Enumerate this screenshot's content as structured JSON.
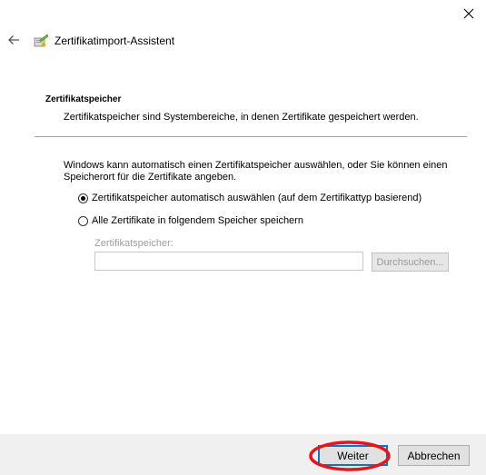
{
  "window": {
    "title": "Zertifikatimport-Assistent"
  },
  "header": {
    "close_icon": "close-icon",
    "back_icon": "back-arrow-icon",
    "wizard_icon": "certificate-wizard-icon"
  },
  "section": {
    "heading": "Zertifikatspeicher",
    "description": "Zertifikatspeicher sind Systembereiche, in denen Zertifikate gespeichert werden."
  },
  "body": {
    "intro": "Windows kann automatisch einen Zertifikatspeicher auswählen, oder Sie können einen Speicherort für die Zertifikate angeben.",
    "options": [
      {
        "label": "Zertifikatspeicher automatisch auswählen (auf dem Zertifikattyp basierend)",
        "selected": true
      },
      {
        "label": "Alle Zertifikate in folgendem Speicher speichern",
        "selected": false
      }
    ],
    "store_label": "Zertifikatspeicher:",
    "store_value": "",
    "browse_label": "Durchsuchen..."
  },
  "footer": {
    "next_label": "Weiter",
    "cancel_label": "Abbrechen"
  },
  "colors": {
    "accent": "#0078d7",
    "highlight": "#e8141b",
    "footer_bg": "#f0f0f0"
  }
}
